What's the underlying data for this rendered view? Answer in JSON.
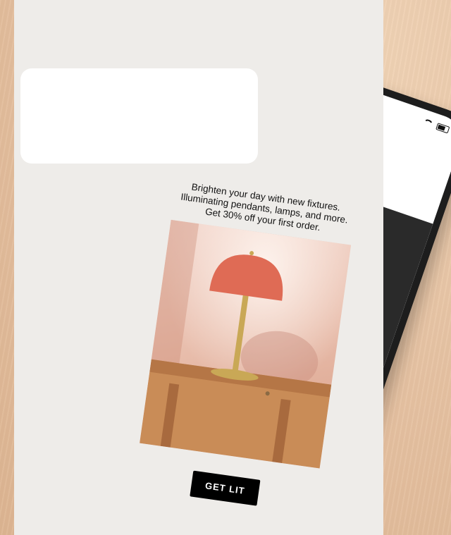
{
  "promo": {
    "line1": "Brighten your day with new fixtures.",
    "line2": "Illuminating pendants, lamps, and more.",
    "line3": "Get 30% off your first order.",
    "cta_label": "GET LIT"
  },
  "colors": {
    "lamp_shade": "#df6b55",
    "lamp_brass": "#c9a856",
    "table_wood": "#c98c57",
    "cta_background": "#000000"
  },
  "icons": {
    "status": [
      "wifi-icon",
      "battery-icon"
    ]
  }
}
